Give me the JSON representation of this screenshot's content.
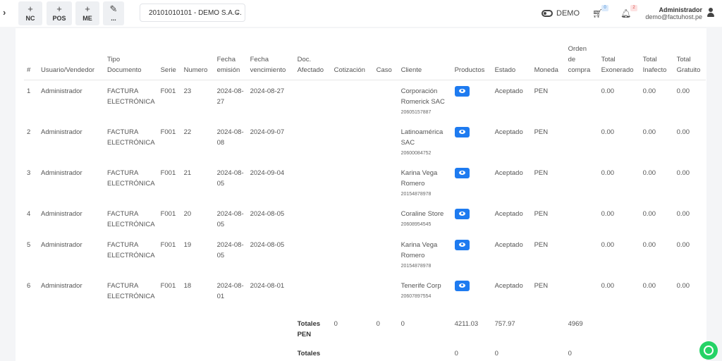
{
  "topbar": {
    "quick_buttons": [
      {
        "icon": "+",
        "label": "NC"
      },
      {
        "icon": "+",
        "label": "POS"
      },
      {
        "icon": "+",
        "label": "ME"
      },
      {
        "icon": "✎",
        "label": "..."
      }
    ],
    "company": "20101010101 - DEMO S.A.C.",
    "demo_label": "DEMO",
    "cart_count": "0",
    "notifications_count": "2",
    "user_name": "Administrador",
    "user_email": "demo@factuhost.pe"
  },
  "table": {
    "headers": [
      "#",
      "Usuario/Vendedor",
      "Tipo Documento",
      "Serie",
      "Numero",
      "Fecha emisión",
      "Fecha vencimiento",
      "Doc. Afectado",
      "Cotización",
      "Caso",
      "Cliente",
      "Productos",
      "Estado",
      "Moneda",
      "Orden de compra",
      "Total Exonerado",
      "Total Inafecto",
      "Total Gratuito"
    ],
    "rows": [
      {
        "n": "1",
        "user": "Administrador",
        "doc_type": "FACTURA ELECTRÓNICA",
        "serie": "F001",
        "numero": "23",
        "emision": "2024-08-27",
        "vencimiento": "2024-08-27",
        "client": "Corporación Romerick SAC",
        "client_doc": "20605157887",
        "estado": "Aceptado",
        "moneda": "PEN",
        "exonerado": "0.00",
        "inafecto": "0.00",
        "gratuito": "0.00"
      },
      {
        "n": "2",
        "user": "Administrador",
        "doc_type": "FACTURA ELECTRÓNICA",
        "serie": "F001",
        "numero": "22",
        "emision": "2024-08-08",
        "vencimiento": "2024-09-07",
        "client": "Latinoamérica SAC",
        "client_doc": "20600084752",
        "estado": "Aceptado",
        "moneda": "PEN",
        "exonerado": "0.00",
        "inafecto": "0.00",
        "gratuito": "0.00"
      },
      {
        "n": "3",
        "user": "Administrador",
        "doc_type": "FACTURA ELECTRÓNICA",
        "serie": "F001",
        "numero": "21",
        "emision": "2024-08-05",
        "vencimiento": "2024-09-04",
        "client": "Karina Vega Romero",
        "client_doc": "20154878978",
        "estado": "Aceptado",
        "moneda": "PEN",
        "exonerado": "0.00",
        "inafecto": "0.00",
        "gratuito": "0.00"
      },
      {
        "n": "4",
        "user": "Administrador",
        "doc_type": "FACTURA ELECTRÓNICA",
        "serie": "F001",
        "numero": "20",
        "emision": "2024-08-05",
        "vencimiento": "2024-08-05",
        "client": "Coraline Store",
        "client_doc": "20608954545",
        "estado": "Aceptado",
        "moneda": "PEN",
        "exonerado": "0.00",
        "inafecto": "0.00",
        "gratuito": "0.00"
      },
      {
        "n": "5",
        "user": "Administrador",
        "doc_type": "FACTURA ELECTRÓNICA",
        "serie": "F001",
        "numero": "19",
        "emision": "2024-08-05",
        "vencimiento": "2024-08-05",
        "client": "Karina Vega Romero",
        "client_doc": "20154878978",
        "estado": "Aceptado",
        "moneda": "PEN",
        "exonerado": "0.00",
        "inafecto": "0.00",
        "gratuito": "0.00"
      },
      {
        "n": "6",
        "user": "Administrador",
        "doc_type": "FACTURA ELECTRÓNICA",
        "serie": "F001",
        "numero": "18",
        "emision": "2024-08-01",
        "vencimiento": "2024-08-01",
        "client": "Tenerife Corp",
        "client_doc": "20607897554",
        "estado": "Aceptado",
        "moneda": "PEN",
        "exonerado": "0.00",
        "inafecto": "0.00",
        "gratuito": "0.00"
      }
    ],
    "totals_pen": {
      "label": "Totales PEN",
      "cotizacion": "0",
      "caso": "0",
      "cliente": "0",
      "productos": "4211.03",
      "estado": "757.97",
      "orden": "4969"
    },
    "totals_usd": {
      "label": "Totales USD",
      "productos": "0",
      "estado": "0",
      "orden": "0"
    }
  },
  "colors": {
    "eye_button": "#1e7bf0",
    "whatsapp": "#25d366"
  }
}
